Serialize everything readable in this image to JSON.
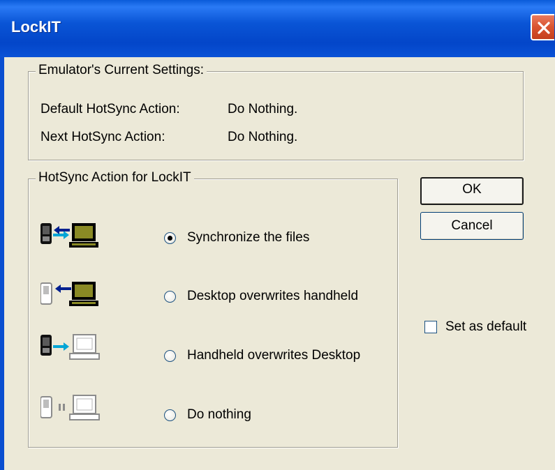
{
  "window": {
    "title": "LockIT",
    "close_icon": "close-icon"
  },
  "current_settings": {
    "legend": "Emulator's Current Settings:",
    "rows": [
      {
        "label": "Default HotSync Action:",
        "value": "Do Nothing."
      },
      {
        "label": "Next HotSync Action:",
        "value": "Do Nothing."
      }
    ]
  },
  "action_group": {
    "legend": "HotSync Action for LockIT",
    "options": [
      {
        "label": "Synchronize the files",
        "icon": "sync-both-icon",
        "checked": true
      },
      {
        "label": "Desktop overwrites handheld",
        "icon": "desktop-to-handheld-icon",
        "checked": false
      },
      {
        "label": "Handheld overwrites Desktop",
        "icon": "handheld-to-desktop-icon",
        "checked": false
      },
      {
        "label": "Do nothing",
        "icon": "do-nothing-icon",
        "checked": false
      }
    ]
  },
  "buttons": {
    "ok": "OK",
    "cancel": "Cancel"
  },
  "set_default": {
    "label": "Set as default",
    "checked": false
  }
}
